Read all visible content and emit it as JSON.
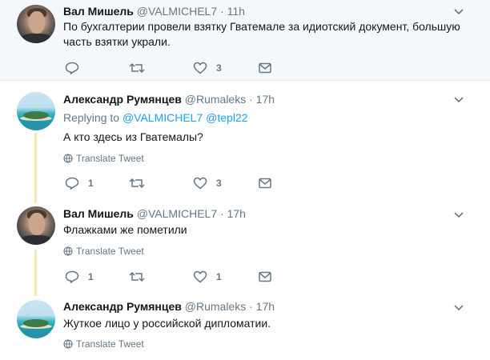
{
  "tweets": [
    {
      "name": "Вал Мишель",
      "handle": "@VALMICHEL7",
      "sep": "·",
      "time": "11h",
      "text": "По бухгалтерии провели взятку Гватемале за идиотский документ, большую часть взятки украли.",
      "reply_count": "",
      "retweet_count": "",
      "like_count": "3"
    },
    {
      "name": "Александр Румянцев",
      "handle": "@Rumaleks",
      "sep": "·",
      "time": "17h",
      "replying_to_label": "Replying to",
      "replying_to_1": "@VALMICHEL7",
      "replying_to_2": "@tepl22",
      "text": "А кто здесь из Гватемалы?",
      "translate": "Translate Tweet",
      "reply_count": "1",
      "retweet_count": "",
      "like_count": "3"
    },
    {
      "name": "Вал Мишель",
      "handle": "@VALMICHEL7",
      "sep": "·",
      "time": "17h",
      "text": "Флажками же пометили",
      "translate": "Translate Tweet",
      "reply_count": "1",
      "retweet_count": "",
      "like_count": "1"
    },
    {
      "name": "Александр Румянцев",
      "handle": "@Rumaleks",
      "sep": "·",
      "time": "17h",
      "text": "Жуткое лицо у российской дипломатии.",
      "translate": "Translate Tweet"
    }
  ],
  "icons": {
    "reply": "reply-icon",
    "retweet": "retweet-icon",
    "like": "heart-icon",
    "dm": "envelope-icon",
    "caret": "chevron-down-icon",
    "globe": "globe-icon"
  },
  "colors": {
    "accent": "#1da1f2",
    "muted": "#657786",
    "thread_line": "#e1e8ed",
    "highlight_bg": "#f5f8fa"
  }
}
